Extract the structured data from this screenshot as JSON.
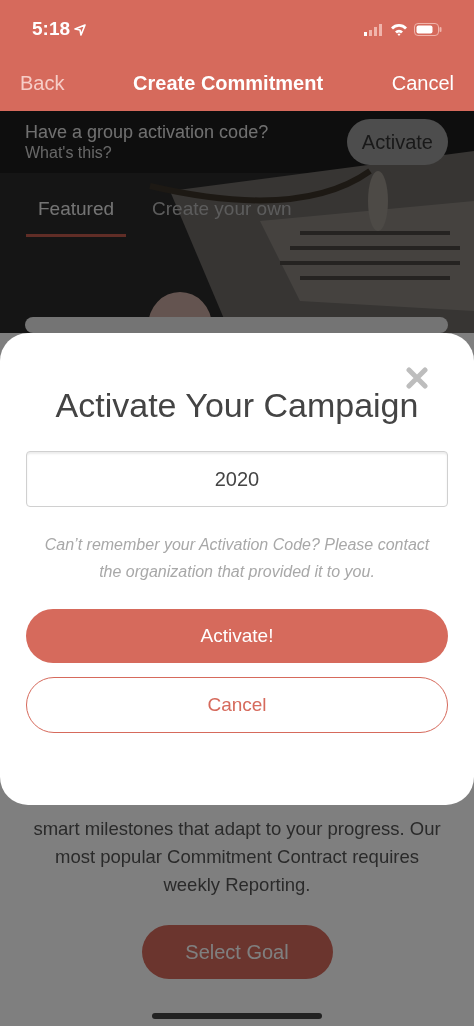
{
  "status_bar": {
    "time": "5:18"
  },
  "nav": {
    "back": {
      "label": "Back",
      "disabled": true
    },
    "title": "Create Commitment",
    "cancel": "Cancel"
  },
  "activation_banner": {
    "prompt": "Have a group activation code?",
    "link": "What's this?",
    "button": "Activate"
  },
  "tabs": [
    {
      "label": "Featured",
      "selected": true
    },
    {
      "label": "Create your own",
      "selected": false
    }
  ],
  "description": "smart milestones that adapt to your progress. Our most popular Commitment Contract requires weekly Reporting.",
  "select_goal_button": "Select Goal",
  "modal": {
    "title": "Activate Your Campaign",
    "code_field": {
      "value": "2020"
    },
    "hint": "Can’t remember your Activation Code? Please contact the organization that provided it to you.",
    "primary_button": "Activate!",
    "secondary_button": "Cancel"
  }
}
